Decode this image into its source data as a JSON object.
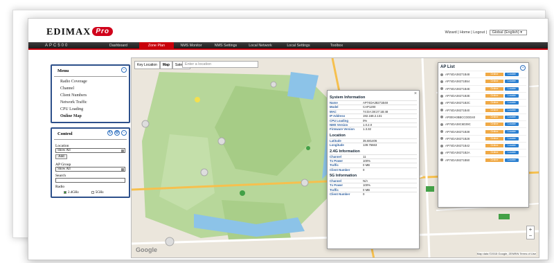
{
  "header": {
    "logo_text": "EDIMAX",
    "logo_badge": "Pro",
    "links": "Wizard | Home | Logout |",
    "language": "Global (English)"
  },
  "nav": {
    "model": "APC500",
    "items": [
      {
        "label": "Dashboard"
      },
      {
        "label": "Zone Plan",
        "active": true
      },
      {
        "label": "NMS Monitor"
      },
      {
        "label": "NMS Settings"
      },
      {
        "label": "Local Network"
      },
      {
        "label": "Local Settings"
      },
      {
        "label": "Toolbox"
      }
    ]
  },
  "menu": {
    "title": "Menu",
    "items": [
      {
        "label": "Radio Coverage"
      },
      {
        "label": "Channel"
      },
      {
        "label": "Client Numbers"
      },
      {
        "label": "Network Traffic"
      },
      {
        "label": "CPU Loading"
      },
      {
        "label": "Online Map",
        "bold": true
      }
    ]
  },
  "control": {
    "title": "Control",
    "location_label": "Location",
    "location_value": "Show All",
    "add_label": "Add",
    "ap_group_label": "AP Group",
    "ap_group_value": "Show All",
    "search_label": "Search",
    "radio_label": "Radio",
    "radio_24": "2.4GHz",
    "radio_5": "5GHz"
  },
  "map": {
    "tabs": [
      "Key Location",
      "Map",
      "Satellite"
    ],
    "location_placeholder": "Enter a location",
    "google_label": "Google",
    "copyright": "Map data ©2015 Google, ZENRIN  Terms of Use"
  },
  "system_info": {
    "title": "System Information",
    "rows": [
      {
        "k": "Name",
        "v": "AP74DA38271B48"
      },
      {
        "k": "Model",
        "v": "CAP1200"
      },
      {
        "k": "MAC",
        "v": "74:DA:38:27:1B:48"
      },
      {
        "k": "IP Address",
        "v": "192.168.2.131"
      },
      {
        "k": "CPU Loading",
        "v": "0%"
      },
      {
        "k": "NMS Version",
        "v": "1.0.2.0"
      },
      {
        "k": "Firmware Version",
        "v": "1.3.32"
      }
    ],
    "location_title": "Location",
    "location_rows": [
      {
        "k": "Latitude",
        "v": "35.681406"
      },
      {
        "k": "Longitude",
        "v": "139.75663"
      }
    ],
    "g24_title": "2.4G Information",
    "g24_rows": [
      {
        "k": "Channel",
        "v": "11"
      },
      {
        "k": "Tx Power",
        "v": "100%"
      },
      {
        "k": "Traffic",
        "v": "0 MB"
      },
      {
        "k": "Client Number",
        "v": "0"
      }
    ],
    "g5_title": "5G Information",
    "g5_rows": [
      {
        "k": "Channel",
        "v": "N/A"
      },
      {
        "k": "Tx Power",
        "v": "100%"
      },
      {
        "k": "Traffic",
        "v": "0 MB"
      },
      {
        "k": "Client Number",
        "v": "0"
      }
    ]
  },
  "ap_list": {
    "title": "AP List",
    "items": [
      {
        "name": "AP74DA38271B48",
        "status": "Online",
        "action": "Locate"
      },
      {
        "name": "AP74DA38271B54",
        "status": "Online",
        "action": "Locate"
      },
      {
        "name": "AP74DA38271B4E",
        "status": "Online",
        "action": "Locate"
      },
      {
        "name": "AP74DA38271B3E",
        "status": "Online",
        "action": "Locate"
      },
      {
        "name": "AP74DA38271B3C",
        "status": "Online",
        "action": "Locate"
      },
      {
        "name": "AP74DA38271B40",
        "status": "Online",
        "action": "Locate"
      },
      {
        "name": "AP000A0BBCCDDD40",
        "status": "Online",
        "action": "Locate"
      },
      {
        "name": "AP74DA38C6D39C",
        "status": "Online",
        "action": "Locate"
      },
      {
        "name": "AP74DA38271B38",
        "status": "Online",
        "action": "Locate"
      },
      {
        "name": "AP74DA38271B28",
        "status": "Online",
        "action": "Locate"
      },
      {
        "name": "AP74DA38271B42",
        "status": "Online",
        "action": "Locate"
      },
      {
        "name": "AP74DA38271B2A",
        "status": "Online",
        "action": "Locate"
      },
      {
        "name": "AP74DA38271B50",
        "status": "Online",
        "action": "Locate"
      }
    ]
  }
}
